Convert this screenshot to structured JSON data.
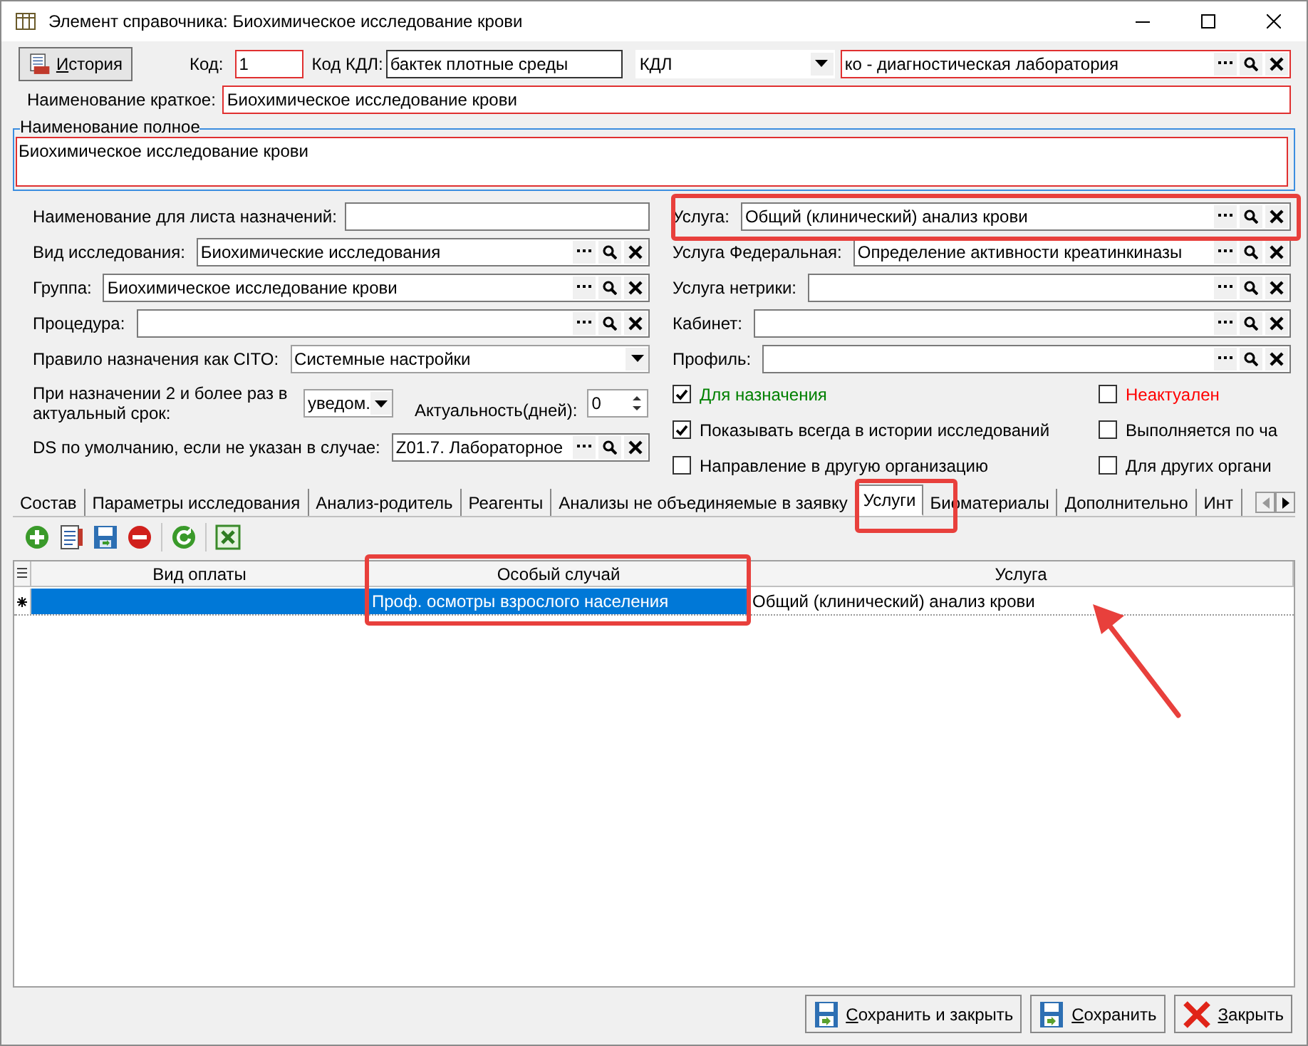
{
  "window": {
    "title": "Элемент справочника: Биохимическое исследование крови"
  },
  "header": {
    "history_button": "История",
    "code_label": "Код:",
    "code": "1",
    "kdl_code_label": "Код КДЛ:",
    "kdl_code": "бактек плотные среды",
    "lab_type": "КДЛ",
    "lab": "ко - диагностическая лаборатория",
    "short_name_label": "Наименование краткое:",
    "short_name": "Биохимическое исследование крови",
    "full_name_label": "Наименование полное",
    "full_name": "Биохимическое исследование крови"
  },
  "left_fields": [
    {
      "kind": "text",
      "label": "Наименование для листа назначений:"
    },
    {
      "kind": "lookup",
      "label": "Вид исследования:",
      "value": "Биохимические исследования"
    },
    {
      "kind": "lookup",
      "label": "Группа:",
      "value": "Биохимическое исследование крови"
    },
    {
      "kind": "lookup",
      "label": "Процедура:"
    },
    {
      "kind": "combo",
      "label": "Правило назначения как CITO:",
      "value": "Системные настройки"
    },
    {
      "kind": "repeat",
      "label": "При назначении 2 и более раз в актуальный срок:",
      "value": "уведом.",
      "spin_label": "Актуальность(дней):",
      "spin_value": "0"
    },
    {
      "kind": "lookup",
      "label": "DS по умолчанию, если не указан в случае:",
      "value": "Z01.7. Лабораторное"
    }
  ],
  "right_fields": [
    {
      "label": "Услуга:",
      "value": "Общий (клинический) анализ крови"
    },
    {
      "label": "Услуга Федеральная:",
      "value": "Определение активности креатинкиназы"
    },
    {
      "label": "Услуга нетрики:"
    },
    {
      "label": "Кабинет:"
    },
    {
      "label": "Профиль:"
    }
  ],
  "checkboxes": [
    {
      "label": "Для назначения",
      "checked": true,
      "color": "#008000"
    },
    {
      "label": "Неактуален",
      "checked": false,
      "color": "#ff0000"
    },
    {
      "label": "Показывать всегда в истории исследований",
      "checked": true,
      "color": "#000000"
    },
    {
      "label": "Выполняется по ча",
      "checked": false,
      "color": "#000000"
    },
    {
      "label": "Направление в другую организацию",
      "checked": false,
      "color": "#000000"
    },
    {
      "label": "Для других органи",
      "checked": false,
      "color": "#000000"
    }
  ],
  "tabs": [
    {
      "label": "Состав",
      "selected": false
    },
    {
      "label": "Параметры исследования",
      "selected": false
    },
    {
      "label": "Анализ-родитель",
      "selected": false
    },
    {
      "label": "Реагенты",
      "selected": false
    },
    {
      "label": "Анализы не объединяемые в заявку",
      "selected": false
    },
    {
      "label": "Услуги",
      "selected": true
    },
    {
      "label": "Биоматериалы",
      "selected": false
    },
    {
      "label": "Дополнительно",
      "selected": false
    },
    {
      "label": "Инт",
      "selected": false
    }
  ],
  "table": {
    "columns": [
      "Вид оплаты",
      "Особый случай",
      "Услуга"
    ],
    "rows": [
      {
        "selected": true,
        "special_case": "Проф. осмотры взрослого населения",
        "service": "Общий (клинический) анализ крови"
      }
    ]
  },
  "footer_buttons": [
    {
      "kind": "save",
      "label": "Сохранить и закрыть"
    },
    {
      "kind": "save",
      "label": "Сохранить"
    },
    {
      "kind": "close",
      "label": "Закрыть"
    }
  ]
}
